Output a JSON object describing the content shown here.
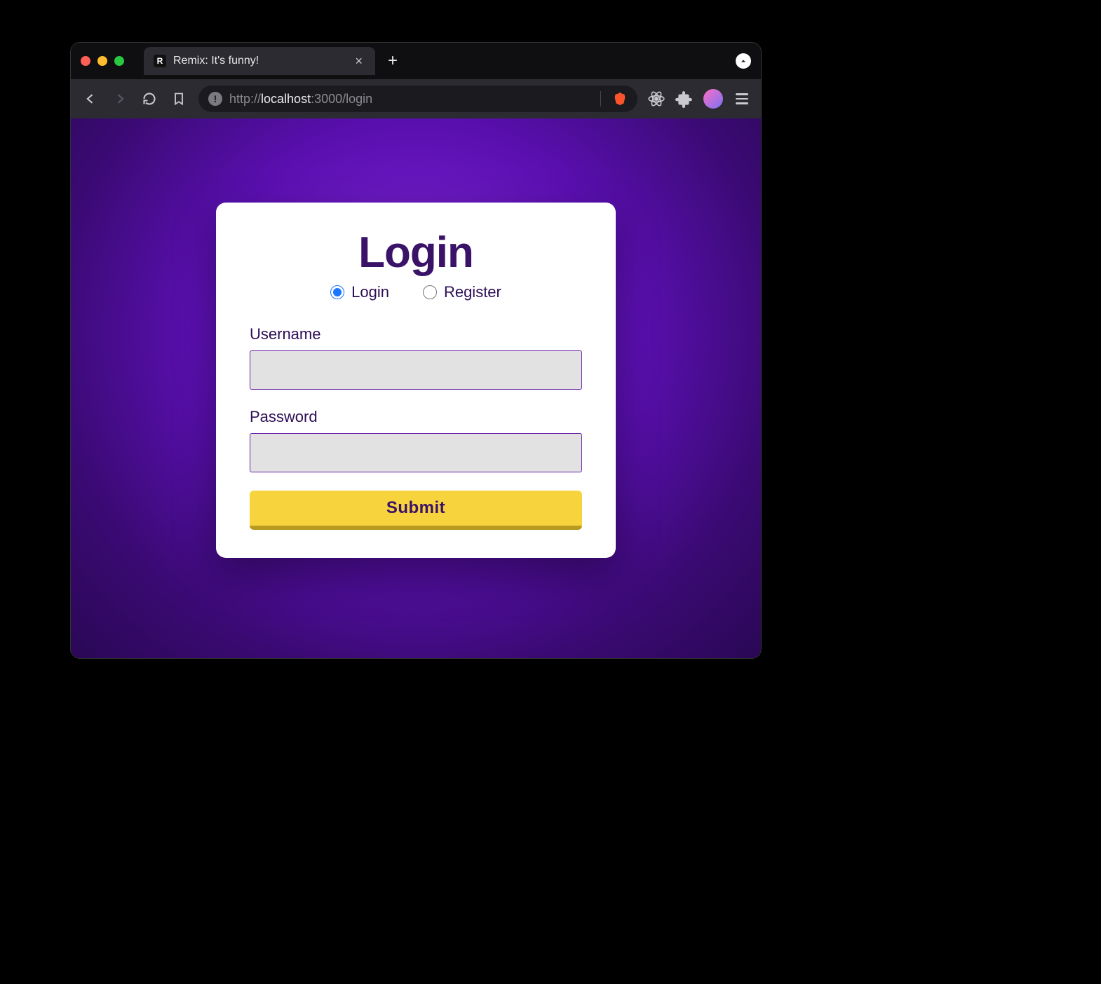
{
  "browser": {
    "tab_title": "Remix: It's funny!",
    "url_scheme": "http://",
    "url_host": "localhost",
    "url_port": ":3000",
    "url_path": "/login"
  },
  "page": {
    "heading": "Login",
    "radios": {
      "login_label": "Login",
      "register_label": "Register",
      "selected": "login"
    },
    "username_label": "Username",
    "username_value": "",
    "password_label": "Password",
    "password_value": "",
    "submit_label": "Submit"
  }
}
